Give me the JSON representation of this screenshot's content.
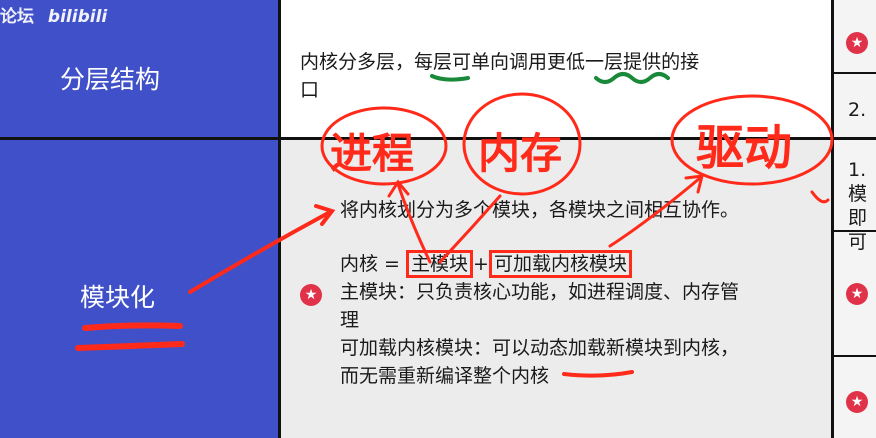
{
  "watermark": {
    "forum": "论坛",
    "brand": "bilibili"
  },
  "rows": [
    {
      "header": "分层结构",
      "content_line1_a": "内核分多层，",
      "content_line1_b": "每层",
      "content_line1_c": "可单向调用",
      "content_line1_d": "更低一层",
      "content_line1_e": "提供的接",
      "content_line2": "口",
      "side": "2."
    },
    {
      "header": "模块化",
      "desc": "将内核划分为多个模块，各模块之间相互协作。",
      "formula_prefix": "内核 = ",
      "formula_main": "主模块",
      "formula_plus": "+",
      "formula_loadable": "可加载内核模块",
      "main_line1": "主模块：只负责核心功能，如进程调度、内存管",
      "main_line2": "理",
      "loadable_line1": "可加载内核模块：可以动态加载新模块到内核，",
      "loadable_line2": "而无需重新编译整个内核",
      "side_a": "1. 模",
      "side_b": "即可"
    }
  ],
  "annotations": {
    "process": "进程",
    "memory": "内存",
    "driver": "驱动"
  },
  "colors": {
    "header_bg": "#4050c8",
    "star": "#e0334a",
    "ink_red": "#ff2a1a",
    "ink_green": "#1a8a3a"
  }
}
